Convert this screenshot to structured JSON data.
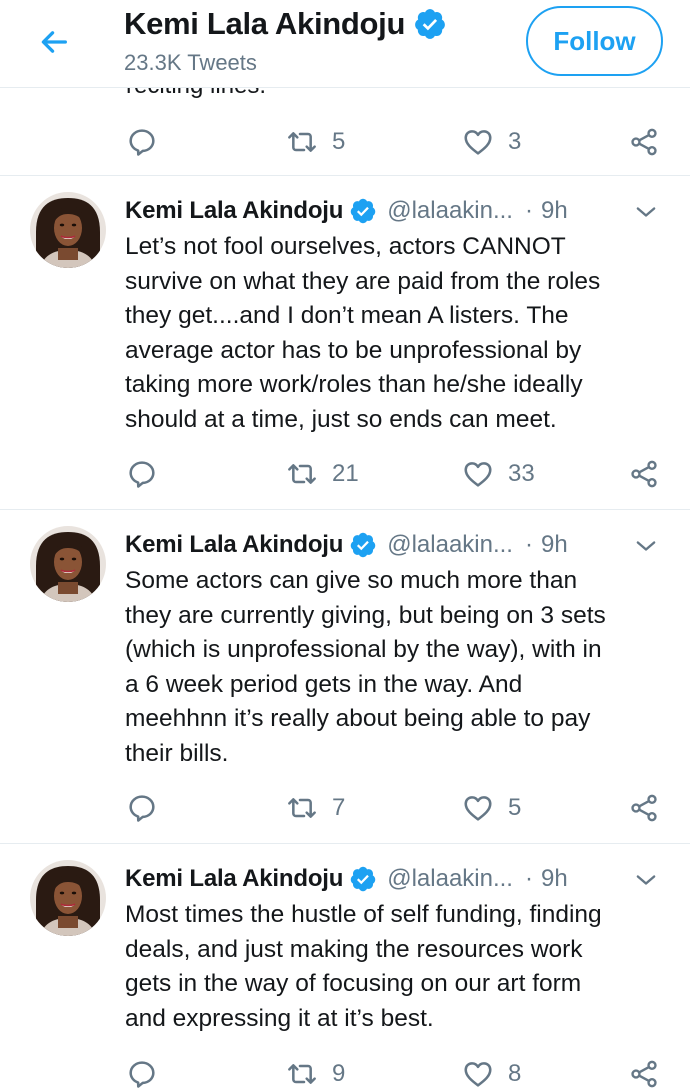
{
  "header": {
    "title": "Kemi Lala Akindoju",
    "tweet_count": "23.3K Tweets",
    "follow_label": "Follow"
  },
  "previous_tweet": {
    "tail_text": "reciting lines.",
    "stats": {
      "replies": "",
      "retweets": "5",
      "likes": "3"
    }
  },
  "tweets": [
    {
      "name": "Kemi Lala Akindoju",
      "handle": "@lalaakin...",
      "dot": "·",
      "time": "9h",
      "lines": [
        "Let’s not fool ourselves, actors CANNOT",
        "survive on what they are paid from the roles",
        "they get....and I don’t mean A listers. The",
        "average actor has to be unprofessional by",
        "taking more work/roles than he/she ideally",
        "should at a time, just so ends can meet."
      ],
      "stats": {
        "replies": "",
        "retweets": "21",
        "likes": "33"
      }
    },
    {
      "name": "Kemi Lala Akindoju",
      "handle": "@lalaakin...",
      "dot": "·",
      "time": "9h",
      "lines": [
        "Some actors can give so much more than",
        "they are currently giving, but being on 3 sets",
        "(which is unprofessional by the way), with in",
        "a 6 week period gets in the way. And",
        "meehhnn it’s really about being able to pay",
        "their bills."
      ],
      "stats": {
        "replies": "",
        "retweets": "7",
        "likes": "5"
      }
    },
    {
      "name": "Kemi Lala Akindoju",
      "handle": "@lalaakin...",
      "dot": "·",
      "time": "9h",
      "lines": [
        "Most times the hustle of self funding, finding",
        "deals, and just making the resources work",
        "gets in the way of focusing on our art form",
        "and expressing it at it’s best."
      ],
      "stats": {
        "replies": "",
        "retweets": "9",
        "likes": "8"
      }
    }
  ],
  "icons": {
    "back": "arrow-left-icon",
    "verified": "verified-badge-icon",
    "caret": "chevron-down-icon",
    "reply": "reply-icon",
    "retweet": "retweet-icon",
    "like": "heart-icon",
    "share": "share-icon"
  },
  "colors": {
    "brand": "#1da1f2",
    "text": "#14171a",
    "muted": "#657786",
    "divider": "#e6ecf0"
  }
}
